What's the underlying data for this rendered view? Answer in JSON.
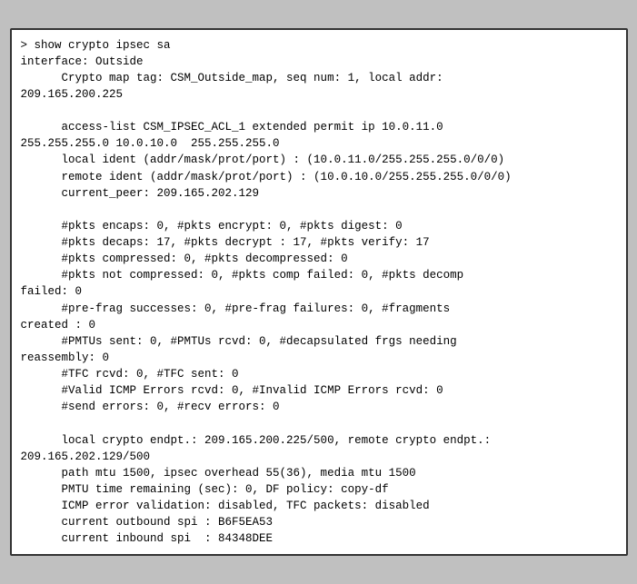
{
  "terminal": {
    "content": [
      "> show crypto ipsec sa",
      "interface: Outside",
      "      Crypto map tag: CSM_Outside_map, seq num: 1, local addr:",
      "209.165.200.225",
      "",
      "      access-list CSM_IPSEC_ACL_1 extended permit ip 10.0.11.0",
      "255.255.255.0 10.0.10.0  255.255.255.0",
      "      local ident (addr/mask/prot/port) : (10.0.11.0/255.255.255.0/0/0)",
      "      remote ident (addr/mask/prot/port) : (10.0.10.0/255.255.255.0/0/0)",
      "      current_peer: 209.165.202.129",
      "",
      "      #pkts encaps: 0, #pkts encrypt: 0, #pkts digest: 0",
      "      #pkts decaps: 17, #pkts decrypt : 17, #pkts verify: 17",
      "      #pkts compressed: 0, #pkts decompressed: 0",
      "      #pkts not compressed: 0, #pkts comp failed: 0, #pkts decomp",
      "failed: 0",
      "      #pre-frag successes: 0, #pre-frag failures: 0, #fragments",
      "created : 0",
      "      #PMTUs sent: 0, #PMTUs rcvd: 0, #decapsulated frgs needing",
      "reassembly: 0",
      "      #TFC rcvd: 0, #TFC sent: 0",
      "      #Valid ICMP Errors rcvd: 0, #Invalid ICMP Errors rcvd: 0",
      "      #send errors: 0, #recv errors: 0",
      "",
      "      local crypto endpt.: 209.165.200.225/500, remote crypto endpt.:",
      "209.165.202.129/500",
      "      path mtu 1500, ipsec overhead 55(36), media mtu 1500",
      "      PMTU time remaining (sec): 0, DF policy: copy-df",
      "      ICMP error validation: disabled, TFC packets: disabled",
      "      current outbound spi : B6F5EA53",
      "      current inbound spi  : 84348DEE"
    ]
  }
}
